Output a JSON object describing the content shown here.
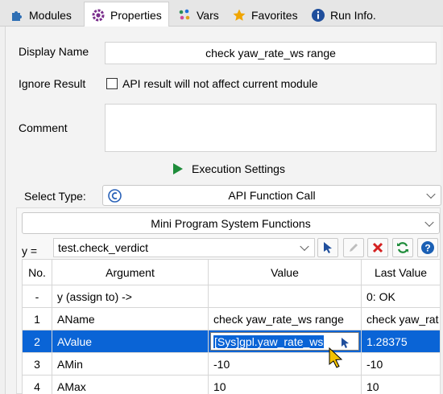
{
  "tabs": [
    {
      "label": "Modules",
      "icon": "puzzle-icon"
    },
    {
      "label": "Properties",
      "icon": "gear-icon"
    },
    {
      "label": "Vars",
      "icon": "dots-icon"
    },
    {
      "label": "Favorites",
      "icon": "star-icon"
    },
    {
      "label": "Run Info.",
      "icon": "info-icon"
    }
  ],
  "form": {
    "display_name_label": "Display Name",
    "display_name_value": "check yaw_rate_ws range",
    "ignore_result_label": "Ignore Result",
    "ignore_result_checkbox_label": "API result will not affect current module",
    "comment_label": "Comment",
    "comment_value": "",
    "execution_settings_label": "Execution Settings",
    "select_type_label": "Select Type:",
    "select_type_value": "API Function Call",
    "function_group_value": "Mini Program System Functions",
    "assign_label": "y =",
    "assign_value": "test.check_verdict"
  },
  "table": {
    "headers": [
      "No.",
      "Argument",
      "Value",
      "Last Value"
    ],
    "rows": [
      {
        "no": "-",
        "argument": "y (assign to) ->",
        "value": "",
        "last": "0: OK"
      },
      {
        "no": "1",
        "argument": "AName",
        "value": "check yaw_rate_ws range",
        "last": "check yaw_rat"
      },
      {
        "no": "2",
        "argument": "AValue",
        "value": "[Sys]gpl.yaw_rate_ws",
        "last": "1.28375"
      },
      {
        "no": "3",
        "argument": "AMin",
        "value": "-10",
        "last": "-10"
      },
      {
        "no": "4",
        "argument": "AMax",
        "value": "10",
        "last": "10"
      }
    ]
  },
  "colors": {
    "accent": "#0a64d6",
    "green": "#1e8c3a",
    "red": "#d42020",
    "help": "#1a5fb4"
  }
}
